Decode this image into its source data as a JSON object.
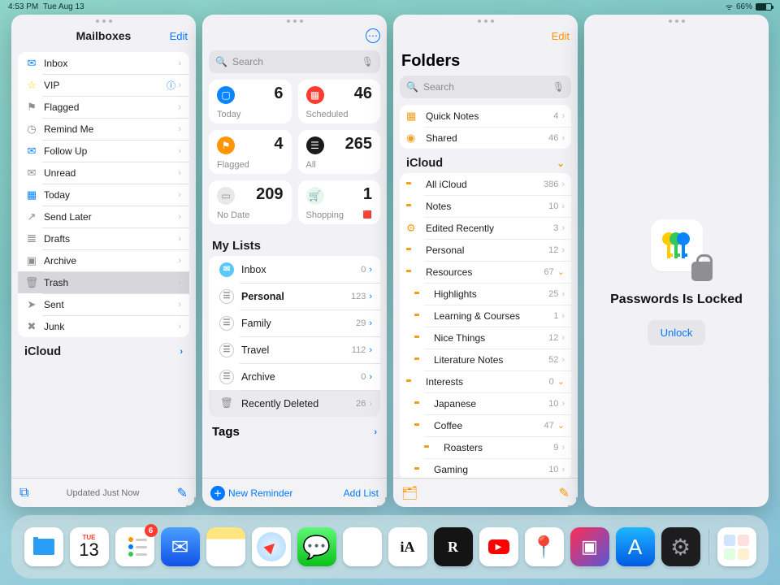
{
  "status": {
    "time": "4:53 PM",
    "date": "Tue Aug 13",
    "battery": "66%"
  },
  "mail": {
    "title": "Mailboxes",
    "edit": "Edit",
    "boxes": [
      {
        "icon": "tray-icon",
        "label": "Inbox",
        "tint": "#0a84ff"
      },
      {
        "icon": "star-icon",
        "label": "VIP",
        "tint": "#ffcc00",
        "info": true
      },
      {
        "icon": "flag-icon",
        "label": "Flagged",
        "tint": "#8e8e93"
      },
      {
        "icon": "clock-icon",
        "label": "Remind Me",
        "tint": "#8e8e93"
      },
      {
        "icon": "followup-icon",
        "label": "Follow Up",
        "tint": "#0a84ff"
      },
      {
        "icon": "envelope-icon",
        "label": "Unread",
        "tint": "#8e8e93"
      },
      {
        "icon": "calendar-icon",
        "label": "Today",
        "tint": "#0a84ff"
      },
      {
        "icon": "sendlater-icon",
        "label": "Send Later",
        "tint": "#8e8e93"
      },
      {
        "icon": "doc-icon",
        "label": "Drafts",
        "tint": "#8e8e93"
      },
      {
        "icon": "archive-icon",
        "label": "Archive",
        "tint": "#8e8e93"
      },
      {
        "icon": "trash-icon",
        "label": "Trash",
        "tint": "#8e8e93",
        "selected": true
      },
      {
        "icon": "paperplane-icon",
        "label": "Sent",
        "tint": "#8e8e93"
      },
      {
        "icon": "junk-icon",
        "label": "Junk",
        "tint": "#8e8e93"
      }
    ],
    "account": "iCloud",
    "footer": "Updated Just Now"
  },
  "reminders": {
    "search": "Search",
    "cards": [
      {
        "name": "today",
        "label": "Today",
        "count": 6,
        "color": "#0a84ff"
      },
      {
        "name": "scheduled",
        "label": "Scheduled",
        "count": 46,
        "color": "#ff3b30"
      },
      {
        "name": "flagged",
        "label": "Flagged",
        "count": 4,
        "color": "#ff9500"
      },
      {
        "name": "all",
        "label": "All",
        "count": 265,
        "color": "#1c1c1e"
      },
      {
        "name": "nodate",
        "label": "No Date",
        "count": 209,
        "color": "#8e8e93"
      },
      {
        "name": "shopping",
        "label": "Shopping",
        "count": 1,
        "color": "#34c759"
      }
    ],
    "listsHeader": "My Lists",
    "lists": [
      {
        "label": "Inbox",
        "count": 0,
        "color": "#5ac8fa",
        "chev": "›"
      },
      {
        "label": "Personal",
        "count": 123,
        "color": "#8e8e93",
        "chev": "›",
        "bold": true
      },
      {
        "label": "Family",
        "count": 29,
        "color": "#8e8e93",
        "chev": "›"
      },
      {
        "label": "Travel",
        "count": 112,
        "color": "#8e8e93",
        "chev": "›"
      },
      {
        "label": "Archive",
        "count": 0,
        "color": "#8e8e93",
        "chev": "›"
      },
      {
        "label": "Recently Deleted",
        "count": 26,
        "color": "#8e8e93",
        "chev": "›",
        "trash": true
      }
    ],
    "tags": "Tags",
    "new": "New Reminder",
    "add": "Add List"
  },
  "notes": {
    "title": "Folders",
    "edit": "Edit",
    "search": "Search",
    "top": [
      {
        "label": "Quick Notes",
        "count": 4,
        "icon": "quicknote-icon"
      },
      {
        "label": "Shared",
        "count": 46,
        "icon": "shared-icon"
      }
    ],
    "account": "iCloud",
    "folders": [
      {
        "label": "All iCloud",
        "count": 386,
        "d": 0,
        "chev": "›"
      },
      {
        "label": "Notes",
        "count": 10,
        "d": 0,
        "chev": "›"
      },
      {
        "label": "Edited Recently",
        "count": 3,
        "d": 0,
        "chev": "›",
        "gear": true
      },
      {
        "label": "Personal",
        "count": 12,
        "d": 0,
        "chev": "›"
      },
      {
        "label": "Resources",
        "count": 67,
        "d": 0,
        "chev": "⌄"
      },
      {
        "label": "Highlights",
        "count": 25,
        "d": 1,
        "chev": "›"
      },
      {
        "label": "Learning & Courses",
        "count": 1,
        "d": 1,
        "chev": "›"
      },
      {
        "label": "Nice Things",
        "count": 12,
        "d": 1,
        "chev": "›"
      },
      {
        "label": "Literature Notes",
        "count": 52,
        "d": 1,
        "chev": "›"
      },
      {
        "label": "Interests",
        "count": 0,
        "d": 0,
        "chev": "⌄"
      },
      {
        "label": "Japanese",
        "count": 10,
        "d": 1,
        "chev": "›"
      },
      {
        "label": "Coffee",
        "count": 47,
        "d": 1,
        "chev": "⌄"
      },
      {
        "label": "Roasters",
        "count": 9,
        "d": 2,
        "chev": "›"
      },
      {
        "label": "Gaming",
        "count": 10,
        "d": 1,
        "chev": "›"
      }
    ]
  },
  "passwords": {
    "title": "Passwords Is Locked",
    "unlock": "Unlock"
  },
  "dock": {
    "apps": [
      {
        "name": "files",
        "bg": "#ffffff"
      },
      {
        "name": "calendar",
        "bg": "#ffffff",
        "text": "13",
        "sub": "TUE"
      },
      {
        "name": "reminders",
        "bg": "#ffffff",
        "badge": "6"
      },
      {
        "name": "mail",
        "bg": "linear-gradient(#4aa0ff,#1051e8)"
      },
      {
        "name": "notes",
        "bg": "linear-gradient(#ffe57f 30%,#fff 30%)"
      },
      {
        "name": "safari",
        "bg": "#ffffff"
      },
      {
        "name": "messages",
        "bg": "linear-gradient(#5ff777,#09c11a)"
      },
      {
        "name": "photos",
        "bg": "#ffffff"
      },
      {
        "name": "ia",
        "bg": "#ffffff",
        "text": "iA"
      },
      {
        "name": "r",
        "bg": "#141414",
        "text": "R"
      },
      {
        "name": "youtube",
        "bg": "#ffffff"
      },
      {
        "name": "maps",
        "bg": "#ffffff"
      },
      {
        "name": "shortcuts",
        "bg": "linear-gradient(135deg,#ff2d55,#5856d6)"
      },
      {
        "name": "appstore",
        "bg": "linear-gradient(#1fb6ff,#0059e3)"
      },
      {
        "name": "settings",
        "bg": "#1d1d1f"
      }
    ],
    "recent": {
      "name": "app-library"
    }
  }
}
